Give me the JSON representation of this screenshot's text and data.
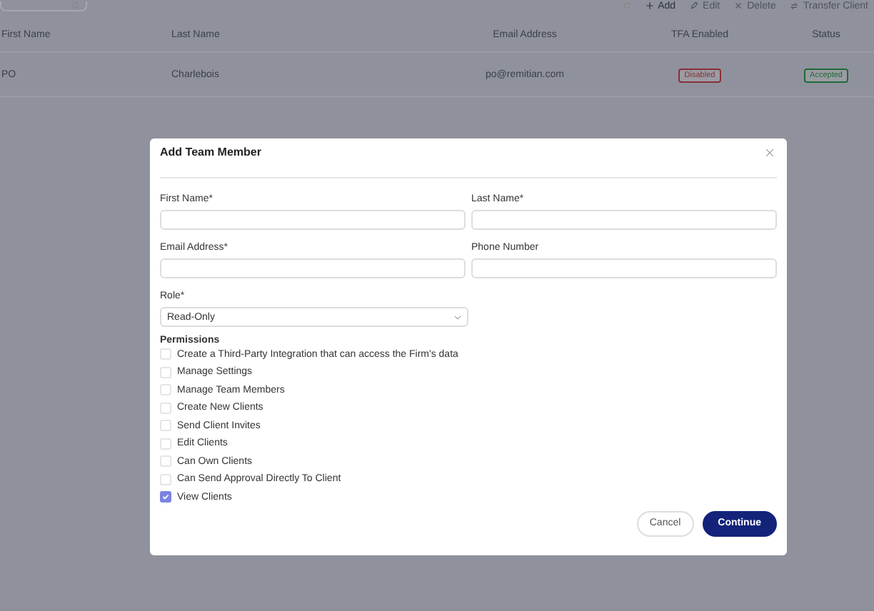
{
  "toolbar": {
    "actions": [
      {
        "label": "Add",
        "kind": "add",
        "disabled": false
      },
      {
        "label": "Edit",
        "kind": "edit",
        "disabled": true
      },
      {
        "label": "Delete",
        "kind": "delete",
        "disabled": true
      },
      {
        "label": "Transfer Client",
        "kind": "transfer",
        "disabled": true
      }
    ]
  },
  "table": {
    "columns": [
      "First Name",
      "Last Name",
      "Email Address",
      "TFA Enabled",
      "Status"
    ],
    "rows": [
      {
        "first_name": "PO",
        "last_name": "Charlebois",
        "email": "po@remitian.com",
        "tfa": {
          "label": "Disabled",
          "color": "#8a2f36"
        },
        "status": {
          "label": "Accepted",
          "color": "#1f6a3a"
        }
      }
    ]
  },
  "dialog": {
    "title": "Add Team Member",
    "fields": [
      {
        "label": "First Name*",
        "kind": "text"
      },
      {
        "label": "Last Name*",
        "kind": "text"
      },
      {
        "label": "Email Address*",
        "kind": "text"
      },
      {
        "label": "Phone Number",
        "kind": "text"
      },
      {
        "label": "Role*",
        "kind": "select",
        "value": "Read-Only"
      }
    ],
    "permissions_title": "Permissions",
    "permissions": [
      {
        "label": "Create a Third-Party Integration that can access the Firm's data",
        "checked": false
      },
      {
        "label": "Manage Settings",
        "checked": false
      },
      {
        "label": "Manage Team Members",
        "checked": false
      },
      {
        "label": "Create New Clients",
        "checked": false
      },
      {
        "label": "Send Client Invites",
        "checked": false
      },
      {
        "label": "Edit Clients",
        "checked": false
      },
      {
        "label": "Can Own Clients",
        "checked": false
      },
      {
        "label": "Can Send Approval Directly To Client",
        "checked": false
      },
      {
        "label": "View Clients",
        "checked": true
      }
    ],
    "buttons": [
      {
        "label": "Cancel",
        "kind": "secondary"
      },
      {
        "label": "Continue",
        "kind": "primary"
      }
    ]
  }
}
